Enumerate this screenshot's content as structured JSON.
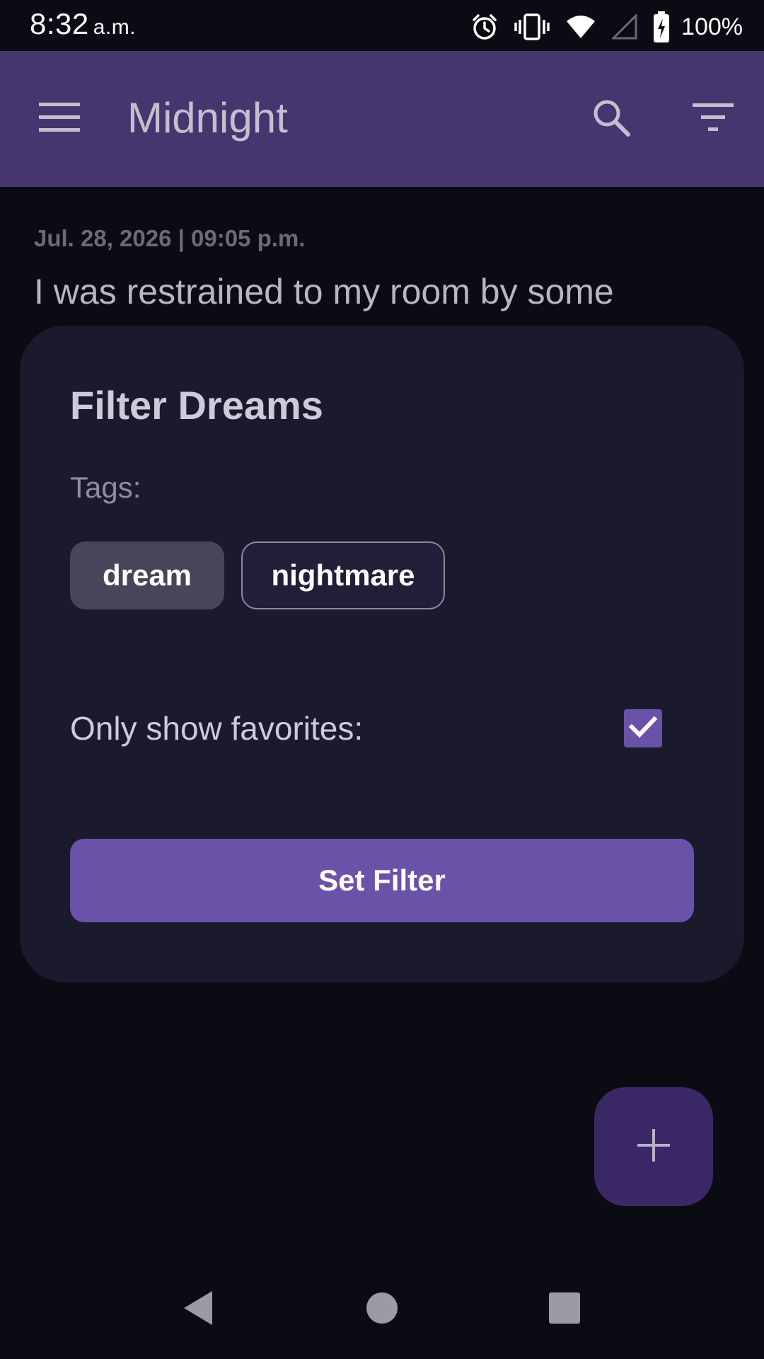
{
  "status_bar": {
    "time": "8:32",
    "ampm": "a.m.",
    "battery": "100%",
    "icons": [
      "alarm-icon",
      "vibrate-icon",
      "wifi-icon",
      "cell-signal-icon",
      "battery-charging-icon"
    ]
  },
  "app_bar": {
    "title": "Midnight",
    "icons": [
      "menu-icon",
      "search-icon",
      "filter-icon"
    ],
    "color": "#463670"
  },
  "entry": {
    "date": "Jul. 28, 2026 | 09:05 p.m.",
    "text": "I was restrained to my room by some"
  },
  "dialog": {
    "title": "Filter Dreams",
    "tags_label": "Tags:",
    "tags": [
      {
        "label": "dream",
        "selected": true
      },
      {
        "label": "nightmare",
        "selected": false
      }
    ],
    "favorites_label": "Only show favorites:",
    "favorites_checked": true,
    "set_filter_label": "Set Filter"
  },
  "fab": {
    "icon": "plus-icon"
  },
  "colors": {
    "accent": "#6a52a8",
    "background": "#0b0b14",
    "dialog": "#1b1a2d"
  }
}
